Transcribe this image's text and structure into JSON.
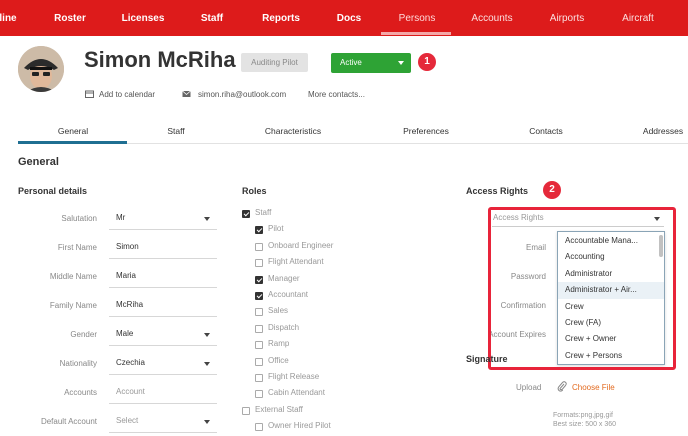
{
  "nav": {
    "items": [
      {
        "label": "line"
      },
      {
        "label": "Roster"
      },
      {
        "label": "Licenses"
      },
      {
        "label": "Staff"
      },
      {
        "label": "Reports"
      },
      {
        "label": "Docs"
      },
      {
        "label": "Persons"
      },
      {
        "label": "Accounts"
      },
      {
        "label": "Airports"
      },
      {
        "label": "Aircraft"
      }
    ],
    "active": "Persons",
    "accent_color": "#dd1b1b"
  },
  "profile": {
    "name": "Simon McRiha",
    "role_badge": "Auditing Pilot",
    "status": "Active",
    "status_color": "#2ea335",
    "add_to_calendar": "Add to calendar",
    "email": "simon.riha@outlook.com",
    "more_contacts": "More contacts..."
  },
  "markers": {
    "first": "1",
    "second": "2",
    "color": "#e5293a"
  },
  "tabs": [
    {
      "label": "General"
    },
    {
      "label": "Staff"
    },
    {
      "label": "Characteristics"
    },
    {
      "label": "Preferences"
    },
    {
      "label": "Contacts"
    },
    {
      "label": "Addresses"
    }
  ],
  "section": {
    "title": "General"
  },
  "personal": {
    "title": "Personal details",
    "fields": [
      {
        "label": "Salutation",
        "value": "Mr"
      },
      {
        "label": "First Name",
        "value": "Simon"
      },
      {
        "label": "Middle Name",
        "value": "Maria"
      },
      {
        "label": "Family Name",
        "value": "McRiha"
      },
      {
        "label": "Gender",
        "value": "Male"
      },
      {
        "label": "Nationality",
        "value": "Czechia"
      },
      {
        "label": "Accounts",
        "value": "Account"
      },
      {
        "label": "Default Account",
        "value": "Select"
      }
    ]
  },
  "roles": {
    "title": "Roles",
    "items": [
      {
        "label": "Staff",
        "checked": true
      },
      {
        "label": "Pilot",
        "checked": true
      },
      {
        "label": "Onboard Engineer",
        "checked": false
      },
      {
        "label": "Flight Attendant",
        "checked": false
      },
      {
        "label": "Manager",
        "checked": true
      },
      {
        "label": "Accountant",
        "checked": true
      },
      {
        "label": "Sales",
        "checked": false
      },
      {
        "label": "Dispatch",
        "checked": false
      },
      {
        "label": "Ramp",
        "checked": false
      },
      {
        "label": "Office",
        "checked": false
      },
      {
        "label": "Flight Release",
        "checked": false
      },
      {
        "label": "Cabin Attendant",
        "checked": false
      },
      {
        "label": "External Staff",
        "checked": false
      },
      {
        "label": "Owner Hired Pilot",
        "checked": false
      }
    ]
  },
  "access": {
    "title": "Access Rights",
    "select_placeholder": "Access Rights",
    "labels": {
      "email": "Email",
      "password": "Password",
      "confirmation": "Confirmation",
      "account_expires": "Account Expires"
    },
    "options": [
      "Accountable Mana...",
      "Accounting",
      "Administrator",
      "Administrator + Air...",
      "Crew",
      "Crew (FA)",
      "Crew + Owner",
      "Crew + Persons"
    ],
    "highlighted_option": "Administrator + Air..."
  },
  "signature": {
    "title": "Signature",
    "upload_label": "Upload",
    "choose_file": "Choose File",
    "formats": "Formats:png,jpg,gif",
    "best_size": "Best size: 500 x 360"
  }
}
